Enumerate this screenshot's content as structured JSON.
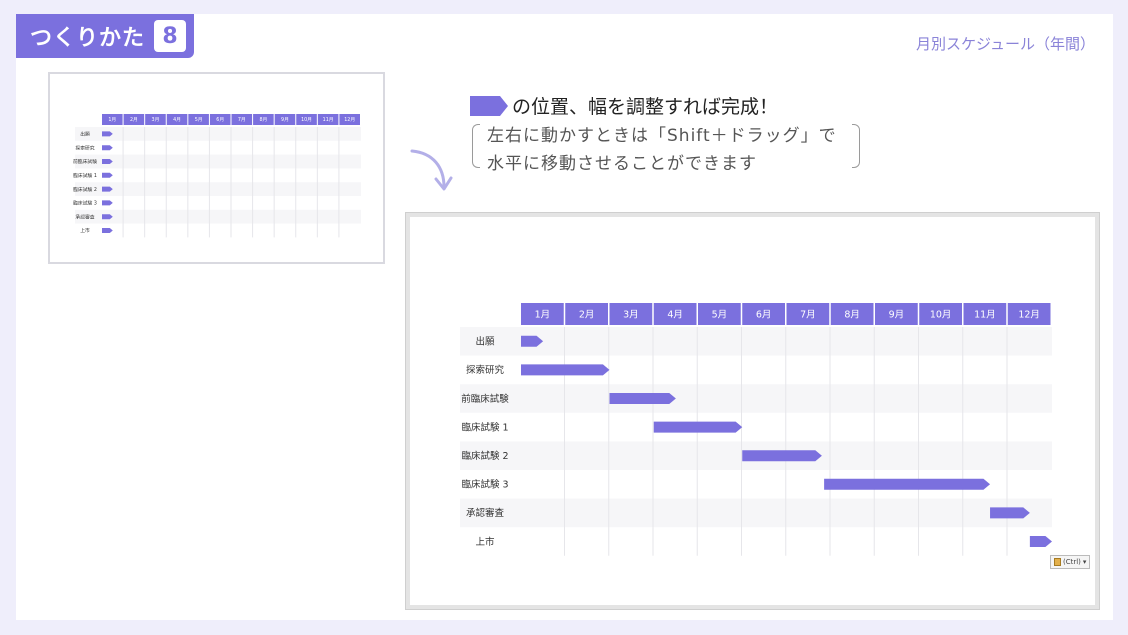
{
  "header": {
    "badge_title": "つくりかた",
    "badge_number": "8",
    "section_label": "月別スケジュール（年間）"
  },
  "callout": {
    "title": "の位置、幅を調整すれば完成！",
    "note_line1": "左右に動かすときは「Shift＋ドラッグ」で",
    "note_line2": "水平に移動させることができます"
  },
  "gantt": {
    "months": [
      "1月",
      "2月",
      "3月",
      "4月",
      "5月",
      "6月",
      "7月",
      "8月",
      "9月",
      "10月",
      "11月",
      "12月"
    ],
    "tasks": [
      {
        "label": "出願",
        "start": 0,
        "end": 0.5
      },
      {
        "label": "探索研究",
        "start": 0,
        "end": 2.0
      },
      {
        "label": "前臨床試験",
        "start": 2.0,
        "end": 3.5
      },
      {
        "label": "臨床試験 1",
        "start": 3.0,
        "end": 5.0
      },
      {
        "label": "臨床試験 2",
        "start": 5.0,
        "end": 6.8
      },
      {
        "label": "臨床試験 3",
        "start": 6.85,
        "end": 10.6
      },
      {
        "label": "承認審査",
        "start": 10.6,
        "end": 11.5
      },
      {
        "label": "上市",
        "start": 11.5,
        "end": 12.0
      }
    ],
    "accent_color": "#7b70de",
    "paste_button": "(Ctrl)"
  },
  "preview": {
    "months": [
      "1月",
      "2月",
      "3月",
      "4月",
      "5月",
      "6月",
      "7月",
      "8月",
      "9月",
      "10月",
      "11月",
      "12月"
    ],
    "tasks": [
      "出願",
      "探索研究",
      "前臨床試験",
      "臨床試験 1",
      "臨床試験 2",
      "臨床試験 3",
      "承認審査",
      "上市"
    ]
  }
}
